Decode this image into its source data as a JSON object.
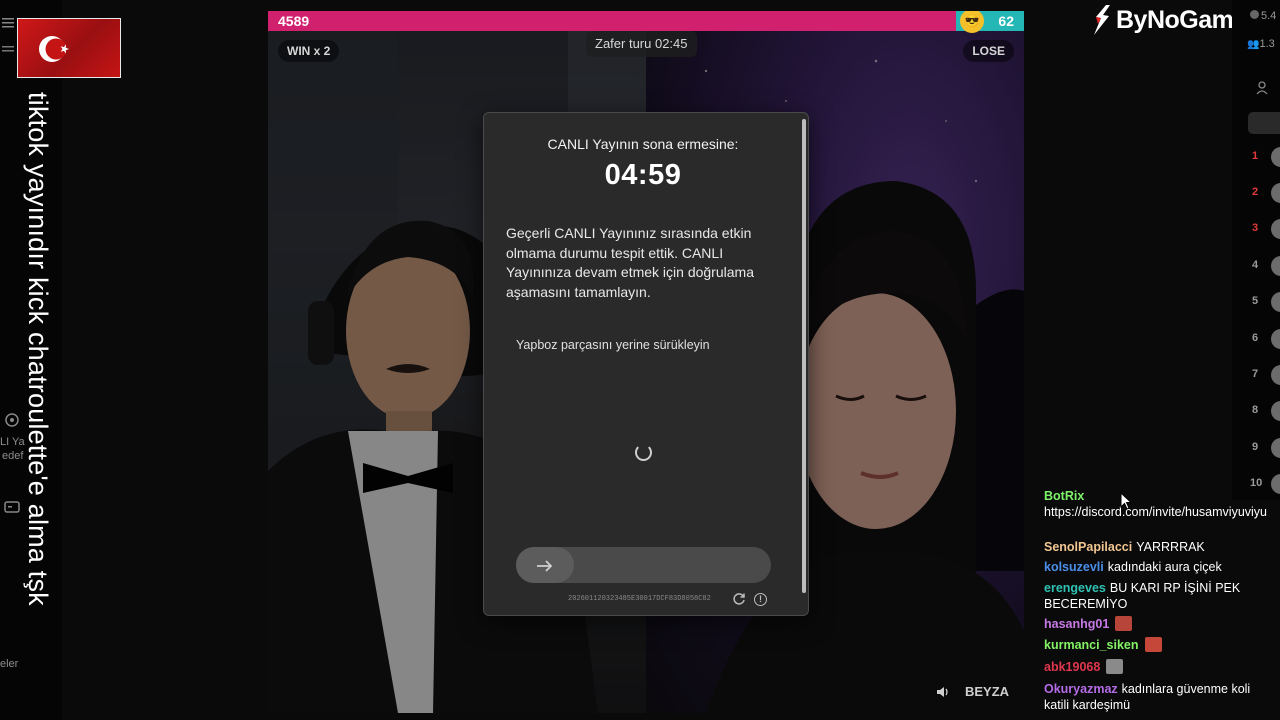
{
  "overlay": {
    "vertical_text": "tiktok yayınıdır kick chatroulette'e alma tşk",
    "left_fragments": [
      "LI Ya",
      "edef",
      "eler"
    ]
  },
  "video": {
    "score_left": "4589",
    "score_right": "62",
    "score_left_fraction": 0.91,
    "multiplier": "WIN x 2",
    "result": "LOSE",
    "round_timer": "Zafer turu 02:45",
    "opponent_name": "BEYZA"
  },
  "modal": {
    "title": "CANLI Yayının sona ermesine:",
    "countdown": "04:59",
    "body": "Geçerli CANLI Yayınınız sırasında etkin olmama durumu tespit ettik. CANLI Yayınınıza devam etmek için doğrulama aşamasını tamamlayın.",
    "hint": "Yapboz parçasını yerine sürükleyin",
    "captcha_id": "202601120323485E30017DCF83D8058C82"
  },
  "brand": {
    "name": "ByNoGame"
  },
  "right_panel": {
    "top_values": [
      "5.4",
      "1.3"
    ],
    "leaderboard_ranks": [
      "1",
      "2",
      "3",
      "4",
      "5",
      "6",
      "7",
      "8",
      "9",
      "10"
    ]
  },
  "chat": {
    "messages": [
      {
        "user": "BotRix",
        "color": "#7ef36a",
        "text": "https://discord.com/invite/husamviyuviyu"
      },
      {
        "user": "SenolPapilacci",
        "color": "#f1c692",
        "text": "YARRRRAK"
      },
      {
        "user": "kolsuzevli",
        "color": "#4a8ee8",
        "text": "kadındaki aura çiçek"
      },
      {
        "user": "erengeves",
        "color": "#2fc2b2",
        "text": "BU KARI RP İŞİNİ PEK BECEREMİYO"
      },
      {
        "user": "hasanhg01",
        "color": "#c77ae6",
        "text": ""
      },
      {
        "user": "kurmanci_siken",
        "color": "#83f264",
        "text": ""
      },
      {
        "user": "abk19068",
        "color": "#e0374e",
        "text": ""
      },
      {
        "user": "Okuryazmaz",
        "color": "#b46be6",
        "text": "kadınlara güvenme koli katili kardeşimü"
      }
    ]
  },
  "colors": {
    "pink_bar": "#d0206e",
    "teal_bar": "#25b6b6",
    "modal_bg": "#2a2a2a"
  }
}
